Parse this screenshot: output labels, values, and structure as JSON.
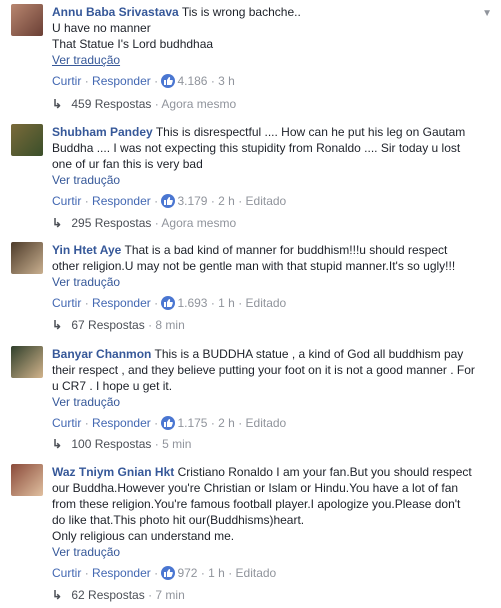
{
  "comments": [
    {
      "author": "Annu Baba Srivastava",
      "lines": [
        "Tis is wrong bachche..",
        "U have no manner",
        "That Statue I's Lord budhdhaa"
      ],
      "translate": "Ver tradução",
      "like": "Curtir",
      "reply": "Responder",
      "likes": "4.186",
      "time": "3 h",
      "edited": "",
      "replies_label": "459 Respostas",
      "replies_ago": "Agora mesmo"
    },
    {
      "author": "Shubham Pandey",
      "lines": [
        "This is disrespectful .... How can he put his leg on Gautam Buddha .... I was not expecting this stupidity from Ronaldo .... Sir today u lost one of ur fan this is very bad"
      ],
      "translate": "Ver tradução",
      "like": "Curtir",
      "reply": "Responder",
      "likes": "3.179",
      "time": "2 h",
      "edited": "Editado",
      "replies_label": "295 Respostas",
      "replies_ago": "Agora mesmo"
    },
    {
      "author": "Yin Htet Aye",
      "lines": [
        "That is a bad kind of manner for buddhism!!!u should respect other religion.U may not be gentle man with that stupid manner.It's so ugly!!!"
      ],
      "translate": "Ver tradução",
      "like": "Curtir",
      "reply": "Responder",
      "likes": "1.693",
      "time": "1 h",
      "edited": "Editado",
      "replies_label": "67 Respostas",
      "replies_ago": "8 min"
    },
    {
      "author": "Banyar Chanmon",
      "lines": [
        "This is a BUDDHA statue , a kind of God all buddhism pay their respect , and they believe putting your foot on it is not a good manner . For u CR7 . I hope u get it."
      ],
      "translate": "Ver tradução",
      "like": "Curtir",
      "reply": "Responder",
      "likes": "1.175",
      "time": "2 h",
      "edited": "Editado",
      "replies_label": "100 Respostas",
      "replies_ago": "5 min"
    },
    {
      "author": "Waz Tniym Gnian Hkt",
      "lines": [
        "Cristiano Ronaldo I am your fan.But you should respect our Buddha.However you're Christian or Islam or Hindu.You have a lot of fan from these religion.You're famous football player.I apologize you.Please don't do like that.This photo hit our(Buddhisms)heart.",
        "Only religious can understand me."
      ],
      "translate": "Ver tradução",
      "like": "Curtir",
      "reply": "Responder",
      "likes": "972",
      "time": "1 h",
      "edited": "Editado",
      "replies_label": "62 Respostas",
      "replies_ago": "7 min"
    }
  ],
  "colors": {
    "link": "#365899",
    "muted": "#90949c",
    "like_badge": "#4a76d1"
  },
  "icons": {
    "like": "thumbs-up-icon",
    "reply_arrow": "reply-arrow-icon",
    "menu": "chevron-down-icon"
  }
}
